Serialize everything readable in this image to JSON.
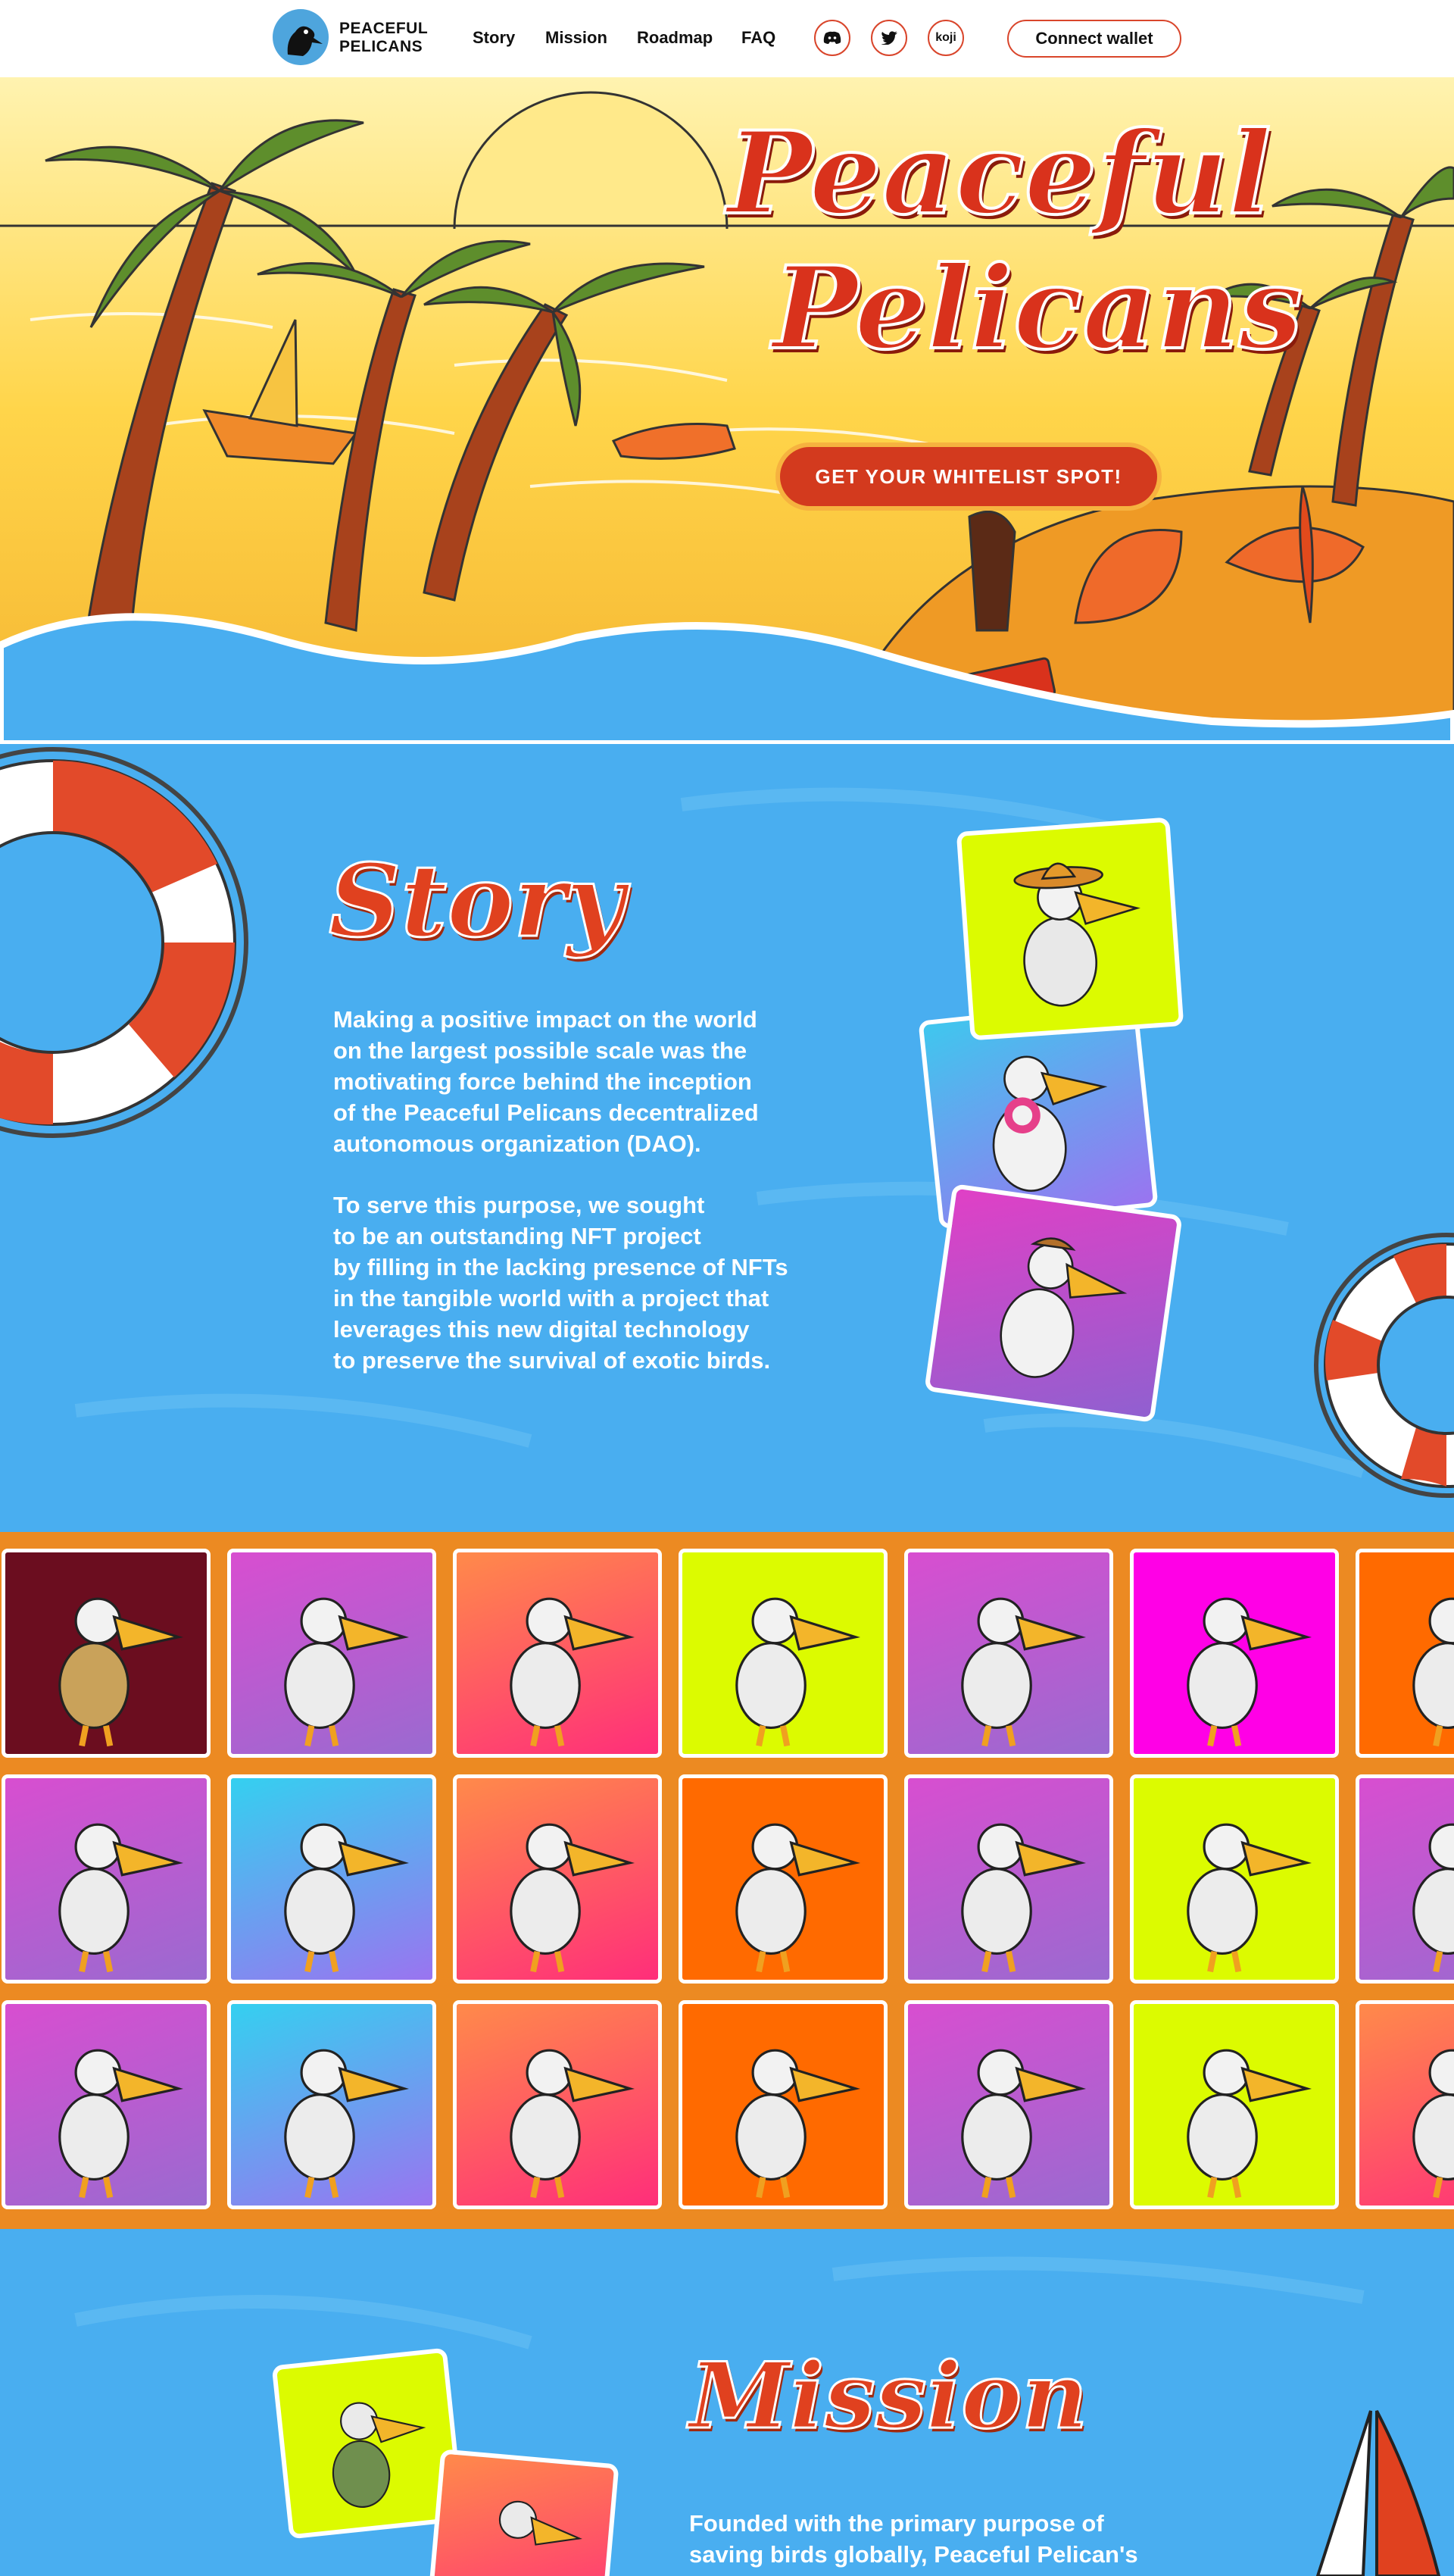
{
  "nav": {
    "logo_text": "PEACEFUL\nPELICANS",
    "links": [
      "Story",
      "Mission",
      "Roadmap",
      "FAQ"
    ],
    "social": [
      {
        "icon": "discord-icon",
        "label": ""
      },
      {
        "icon": "twitter-icon",
        "label": ""
      },
      {
        "icon": "koji-icon",
        "label": "koji"
      }
    ],
    "connect_label": "Connect wallet"
  },
  "hero": {
    "title_line1": "Peaceful",
    "title_line2": "Pelicans",
    "cta_label": "GET YOUR WHITELIST SPOT!"
  },
  "story": {
    "title": "Story",
    "paragraphs": [
      "Making a positive impact on the world\non the largest possible scale was the\nmotivating force behind the inception\nof the Peaceful Pelicans decentralized\nautonomous organization (DAO).",
      "To serve this purpose, we sought\nto be an outstanding NFT project\nby filling in the lacking presence of NFTs\nin the tangible world with a project that\nleverages this new digital technology\nto preserve the survival of exotic birds."
    ]
  },
  "mission": {
    "title": "Mission",
    "text": "Founded with the primary purpose of\nsaving birds globally, Peaceful Pelican's"
  },
  "colors": {
    "brand_red": "#d9321c",
    "ocean_blue": "#49aef0",
    "gallery_orange": "#ec8a22",
    "lime": "#dcfb00",
    "magenta": "#ff00e6"
  },
  "gallery_rows": [
    [
      "#6b0d1f",
      "purple",
      "pink",
      "#dcfb00",
      "purple",
      "#ff00e6",
      "#ff6a00"
    ],
    [
      "purple",
      "bluepurple",
      "pink",
      "#ff6a00",
      "purple",
      "#dcfb00",
      "purple"
    ],
    [
      "purple",
      "bluepurple",
      "pink",
      "#ff6a00",
      "purple",
      "#dcfb00",
      "pink"
    ]
  ]
}
